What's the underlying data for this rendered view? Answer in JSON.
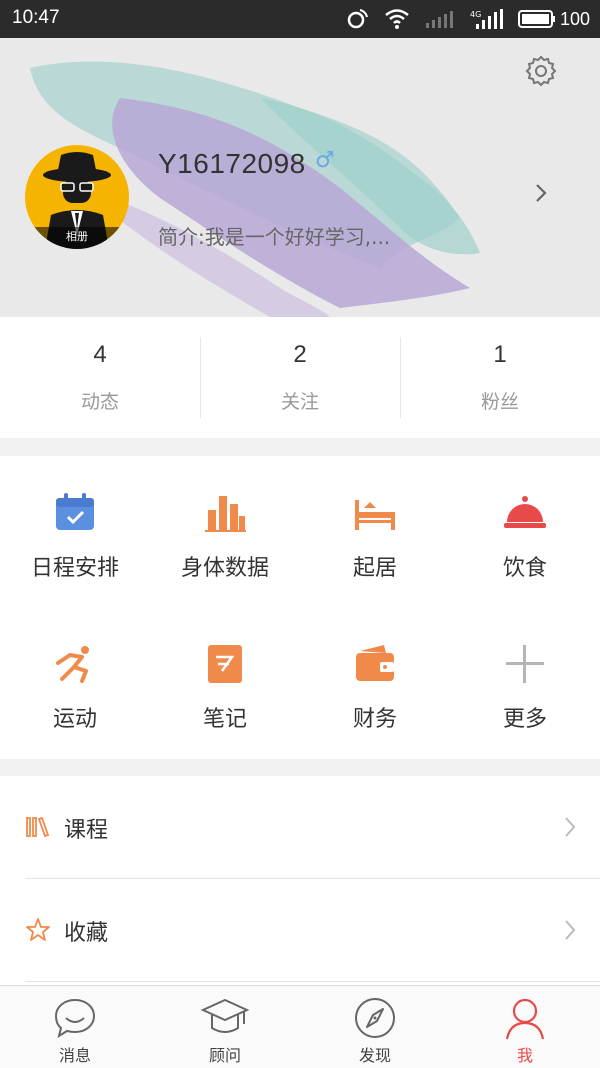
{
  "status_bar": {
    "time": "10:47",
    "network": "4G",
    "battery": "100"
  },
  "profile": {
    "avatar_caption": "相册",
    "name": "Y16172098",
    "gender_symbol": "♂",
    "bio": "简介:我是一个好好学习,..."
  },
  "stats": [
    {
      "count": "4",
      "label": "动态"
    },
    {
      "count": "2",
      "label": "关注"
    },
    {
      "count": "1",
      "label": "粉丝"
    }
  ],
  "features": [
    {
      "label": "日程安排",
      "icon": "calendar-icon",
      "color": "#5b8fe0"
    },
    {
      "label": "身体数据",
      "icon": "bar-chart-icon",
      "color": "#f08a4b"
    },
    {
      "label": "起居",
      "icon": "bed-icon",
      "color": "#f08a4b"
    },
    {
      "label": "饮食",
      "icon": "food-cloche-icon",
      "color": "#e84a4a"
    },
    {
      "label": "运动",
      "icon": "running-icon",
      "color": "#f08a4b"
    },
    {
      "label": "笔记",
      "icon": "note-icon",
      "color": "#f08a4b"
    },
    {
      "label": "财务",
      "icon": "wallet-icon",
      "color": "#f08a4b"
    },
    {
      "label": "更多",
      "icon": "plus-icon",
      "color": "#b5b5b5"
    }
  ],
  "menu": [
    {
      "label": "课程",
      "icon": "books-icon"
    },
    {
      "label": "收藏",
      "icon": "star-icon"
    }
  ],
  "bottom_nav": [
    {
      "label": "消息",
      "icon": "chat-bubble-icon"
    },
    {
      "label": "顾问",
      "icon": "graduation-cap-icon"
    },
    {
      "label": "发现",
      "icon": "compass-icon"
    },
    {
      "label": "我",
      "icon": "person-icon",
      "active": true
    }
  ],
  "colors": {
    "accent": "#e84a4a",
    "orange": "#f08a4b",
    "blue": "#5b8fe0"
  }
}
